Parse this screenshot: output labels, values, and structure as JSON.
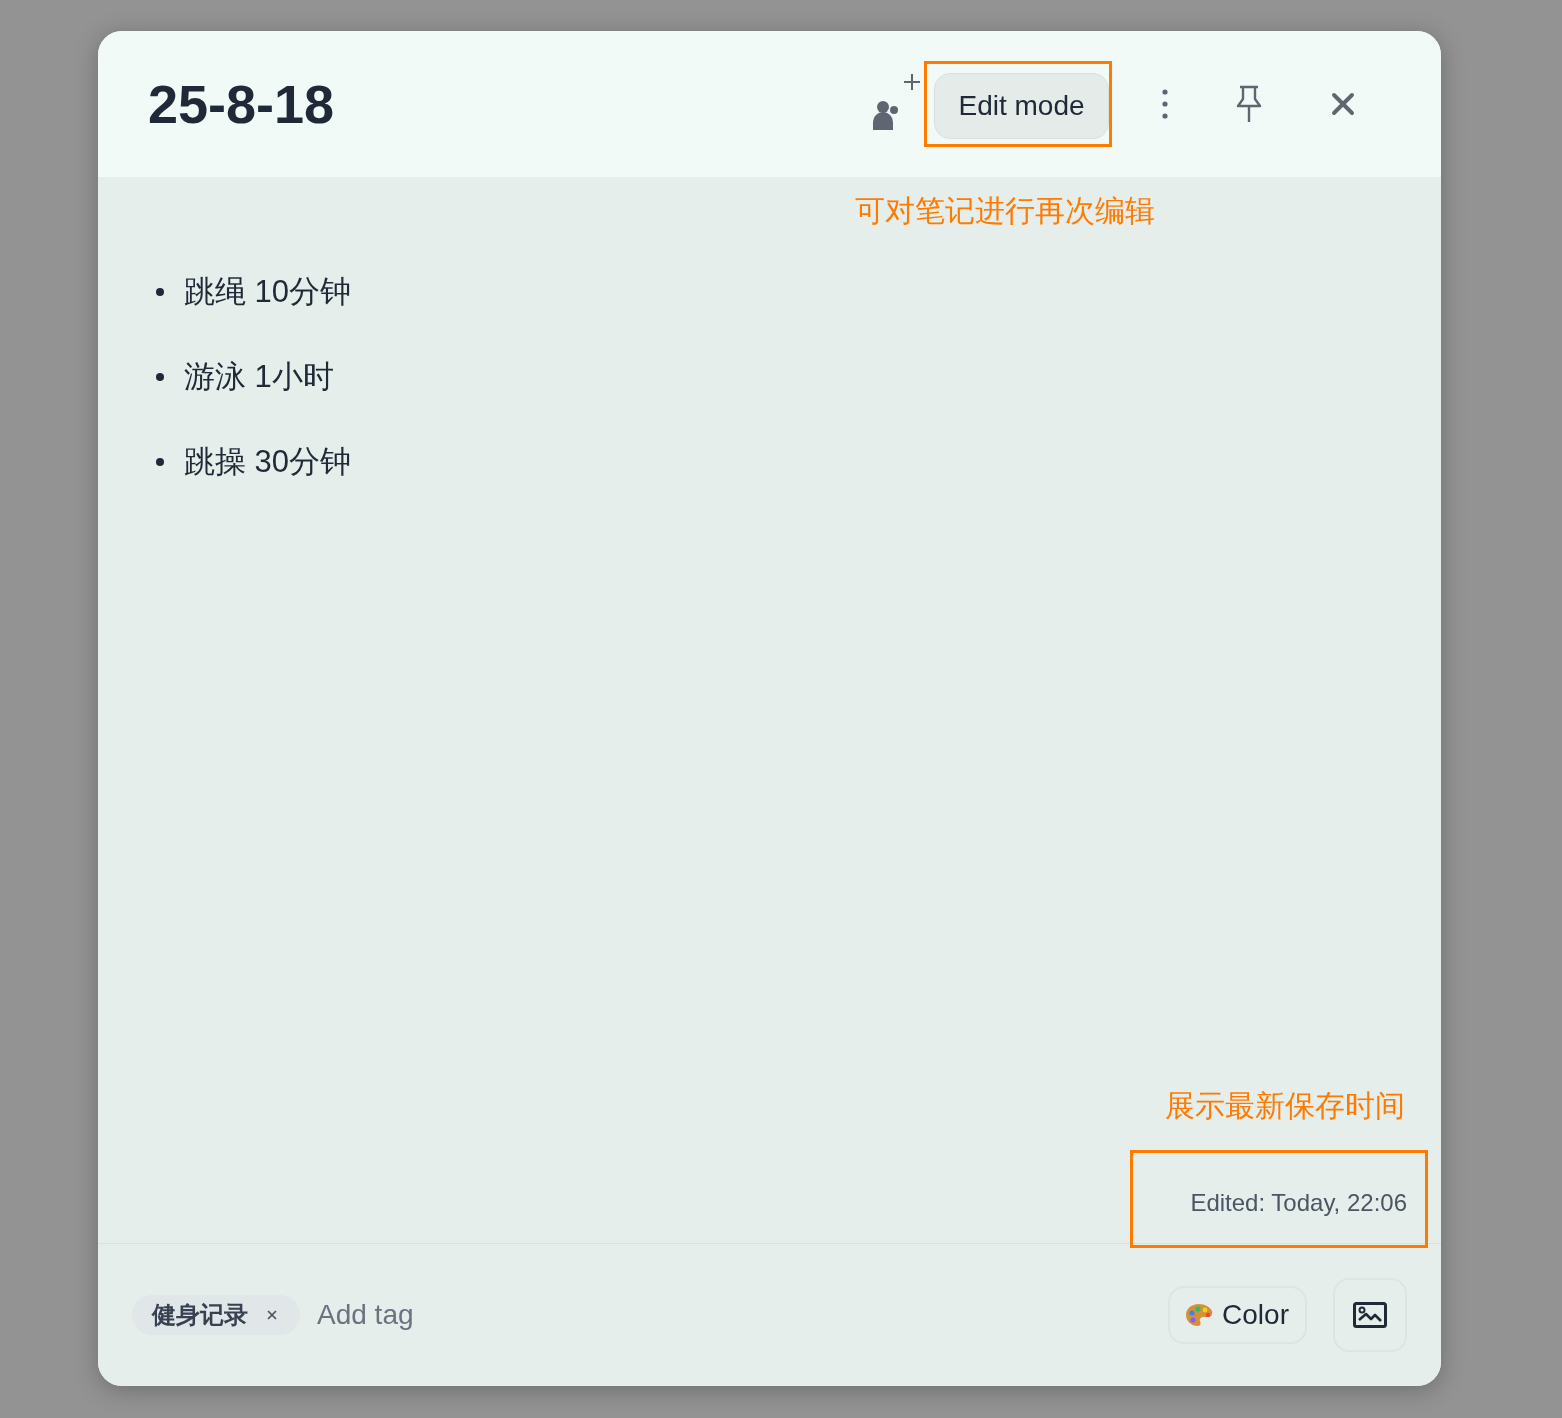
{
  "header": {
    "title": "25-8-18",
    "edit_button": {
      "label": "Edit mode"
    }
  },
  "annotations": [
    {
      "text": "可对笔记进行再次编辑"
    },
    {
      "text": "展示最新保存时间"
    }
  ],
  "note_body": {
    "items": [
      {
        "text": "跳绳 10分钟"
      },
      {
        "text": "游泳 1小时"
      },
      {
        "text": "跳操 30分钟"
      }
    ]
  },
  "edited_time": "Edited: Today, 22:06",
  "footer": {
    "tags": [
      {
        "label": "健身记录"
      }
    ],
    "tag_input": {
      "placeholder": "Add tag"
    },
    "color_button": {
      "label": "Color"
    }
  }
}
